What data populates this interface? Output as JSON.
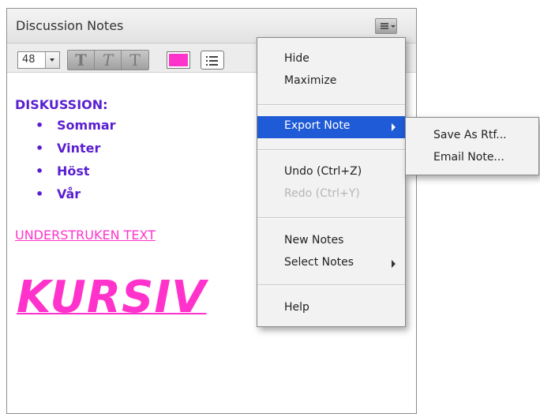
{
  "pod": {
    "title": "Discussion Notes"
  },
  "toolbar": {
    "font_size": "48",
    "bold_glyph": "T",
    "italic_glyph": "T",
    "underline_glyph": "T",
    "text_color": "#ff33cc"
  },
  "note": {
    "text_color_primary": "#5a1fd1",
    "text_color_accent": "#ff33cc",
    "heading": "DISKUSSION:",
    "bullet_glyph": "•",
    "bullets": [
      "Sommar",
      "Vinter",
      "Höst",
      "Vår"
    ],
    "underlined_text": "UNDERSTRUKEN TEXT",
    "italic_text": "KURSIV"
  },
  "menu": {
    "hide": "Hide",
    "maximize": "Maximize",
    "export_note": "Export Note",
    "undo": "Undo (Ctrl+Z)",
    "redo": "Redo (Ctrl+Y)",
    "new_notes": "New Notes",
    "select_notes": "Select Notes",
    "help": "Help",
    "highlight_color": "#1f5bd6"
  },
  "submenu": {
    "save_as_rtf": "Save As Rtf...",
    "email_note": "Email Note..."
  }
}
